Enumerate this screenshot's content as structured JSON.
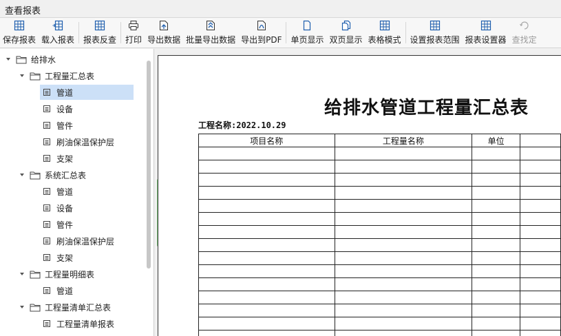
{
  "window": {
    "title": "查看报表"
  },
  "toolbar": {
    "buttons": [
      {
        "key": "save_report",
        "label": "保存报表",
        "icon": "grid-save-icon",
        "disabled": false
      },
      {
        "key": "load_report",
        "label": "载入报表",
        "icon": "grid-load-icon",
        "disabled": false
      },
      {
        "key": "reverse_check",
        "label": "报表反查",
        "icon": "grid-search-icon",
        "disabled": false
      },
      {
        "key": "print",
        "label": "打印",
        "icon": "printer-icon",
        "disabled": false
      },
      {
        "key": "export",
        "label": "导出数据",
        "icon": "export-icon",
        "disabled": false
      },
      {
        "key": "batch_export",
        "label": "批量导出数据",
        "icon": "batch-export-icon",
        "disabled": false
      },
      {
        "key": "export_pdf",
        "label": "导出到PDF",
        "icon": "pdf-icon",
        "disabled": false
      },
      {
        "key": "single_page",
        "label": "单页显示",
        "icon": "single-page-icon",
        "disabled": false
      },
      {
        "key": "double_page",
        "label": "双页显示",
        "icon": "double-page-icon",
        "disabled": false
      },
      {
        "key": "table_mode",
        "label": "表格模式",
        "icon": "table-grid-icon",
        "disabled": false
      },
      {
        "key": "set_range",
        "label": "设置报表范围",
        "icon": "range-grid-icon",
        "disabled": false
      },
      {
        "key": "report_settings",
        "label": "报表设置器",
        "icon": "settings-grid-icon",
        "disabled": false
      },
      {
        "key": "find",
        "label": "查找定",
        "icon": "find-icon",
        "disabled": true
      }
    ]
  },
  "tree": {
    "items": [
      {
        "label": "给排水",
        "level": 0,
        "type": "folder",
        "expanded": true
      },
      {
        "label": "工程量汇总表",
        "level": 1,
        "type": "folder",
        "expanded": true
      },
      {
        "label": "管道",
        "level": 2,
        "type": "doc",
        "selected": true
      },
      {
        "label": "设备",
        "level": 2,
        "type": "doc"
      },
      {
        "label": "管件",
        "level": 2,
        "type": "doc"
      },
      {
        "label": "刷油保温保护层",
        "level": 2,
        "type": "doc"
      },
      {
        "label": "支架",
        "level": 2,
        "type": "doc"
      },
      {
        "label": "系统汇总表",
        "level": 1,
        "type": "folder",
        "expanded": true
      },
      {
        "label": "管道",
        "level": 2,
        "type": "doc"
      },
      {
        "label": "设备",
        "level": 2,
        "type": "doc"
      },
      {
        "label": "管件",
        "level": 2,
        "type": "doc"
      },
      {
        "label": "刷油保温保护层",
        "level": 2,
        "type": "doc"
      },
      {
        "label": "支架",
        "level": 2,
        "type": "doc"
      },
      {
        "label": "工程量明细表",
        "level": 1,
        "type": "folder",
        "expanded": true
      },
      {
        "label": "管道",
        "level": 2,
        "type": "doc"
      },
      {
        "label": "工程量清单汇总表",
        "level": 1,
        "type": "folder",
        "expanded": true
      },
      {
        "label": "工程量清单报表",
        "level": 2,
        "type": "doc"
      }
    ]
  },
  "report": {
    "title": "给排水管道工程量汇总表",
    "project_label": "工程名称:",
    "project_value": "2022.10.29",
    "columns": [
      "项目名称",
      "工程量名称",
      "单位",
      ""
    ],
    "empty_row_count": 15
  },
  "colors": {
    "selected_row": "#cce0f7",
    "splitter_grip": "#7cc47a",
    "icon_blue": "#1f5fae"
  }
}
